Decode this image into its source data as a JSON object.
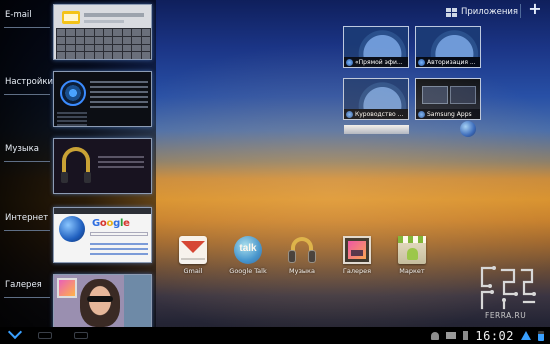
{
  "recent_apps": [
    {
      "label": "E-mail",
      "thumb": "email"
    },
    {
      "label": "Настройки",
      "thumb": "settings"
    },
    {
      "label": "Музыка",
      "thumb": "music"
    },
    {
      "label": "Интернет",
      "thumb": "internet"
    },
    {
      "label": "Галерея",
      "thumb": "gallery"
    }
  ],
  "internet_thumb": {
    "logo_text": "Google"
  },
  "top_bar": {
    "apps_label": "Приложения",
    "add_icon": "plus-icon",
    "add_symbol": "+",
    "apps_icon": "apps-grid-icon"
  },
  "bookmarks": [
    {
      "title": "«Прямой эфи...",
      "style": "globe"
    },
    {
      "title": "Авторизация ...",
      "style": "globe"
    },
    {
      "title": "Куроводство ...",
      "style": "globe"
    },
    {
      "title": "Samsung Apps",
      "style": "screen"
    }
  ],
  "dock_apps": [
    {
      "label": "Gmail",
      "icon": "gmail-icon"
    },
    {
      "label": "Google Talk",
      "icon": "talk-icon",
      "icon_text": "talk"
    },
    {
      "label": "Музыка",
      "icon": "music-icon"
    },
    {
      "label": "Галерея",
      "icon": "gallery-icon"
    },
    {
      "label": "Маркет",
      "icon": "market-icon"
    }
  ],
  "watermark": {
    "text": "FERRA.RU",
    "logo": "ferra-logo"
  },
  "status_bar": {
    "time": "16:02",
    "accent": "#3aa0ff",
    "icons": [
      "android-icon",
      "mail-icon",
      "usb-icon",
      "wifi-icon",
      "battery-icon"
    ]
  }
}
